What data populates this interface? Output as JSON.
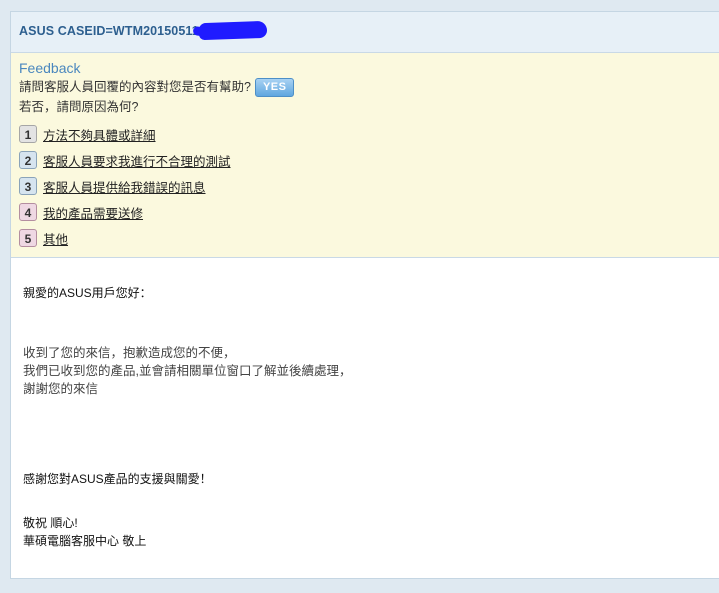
{
  "case": {
    "title": "ASUS CASEID=WTM20150511"
  },
  "feedback": {
    "title": "Feedback",
    "question": "請問客服人員回覆的內容對您是否有幫助?",
    "yes_label": "YES",
    "question2": "若否，請問原因為何?",
    "options": [
      {
        "num": "1",
        "label": "方法不夠具體或詳細",
        "style": "gray"
      },
      {
        "num": "2",
        "label": "客服人員要求我進行不合理的測試",
        "style": "blue"
      },
      {
        "num": "3",
        "label": "客服人員提供給我錯誤的訊息",
        "style": "blue"
      },
      {
        "num": "4",
        "label": "我的產品需要送修",
        "style": "pink"
      },
      {
        "num": "5",
        "label": "其他",
        "style": "pink"
      }
    ]
  },
  "message": {
    "greeting": "親愛的ASUS用戶您好：",
    "line1": "收到了您的來信，抱歉造成您的不便，",
    "line2": "我們已收到您的產品,並會請相關單位窗口了解並後續處理，",
    "line3": "謝謝您的來信",
    "thanks": "感謝您對ASUS產品的支援與關愛！",
    "closing1": "敬祝 順心!",
    "closing2": "華碩電腦客服中心 敬上"
  }
}
